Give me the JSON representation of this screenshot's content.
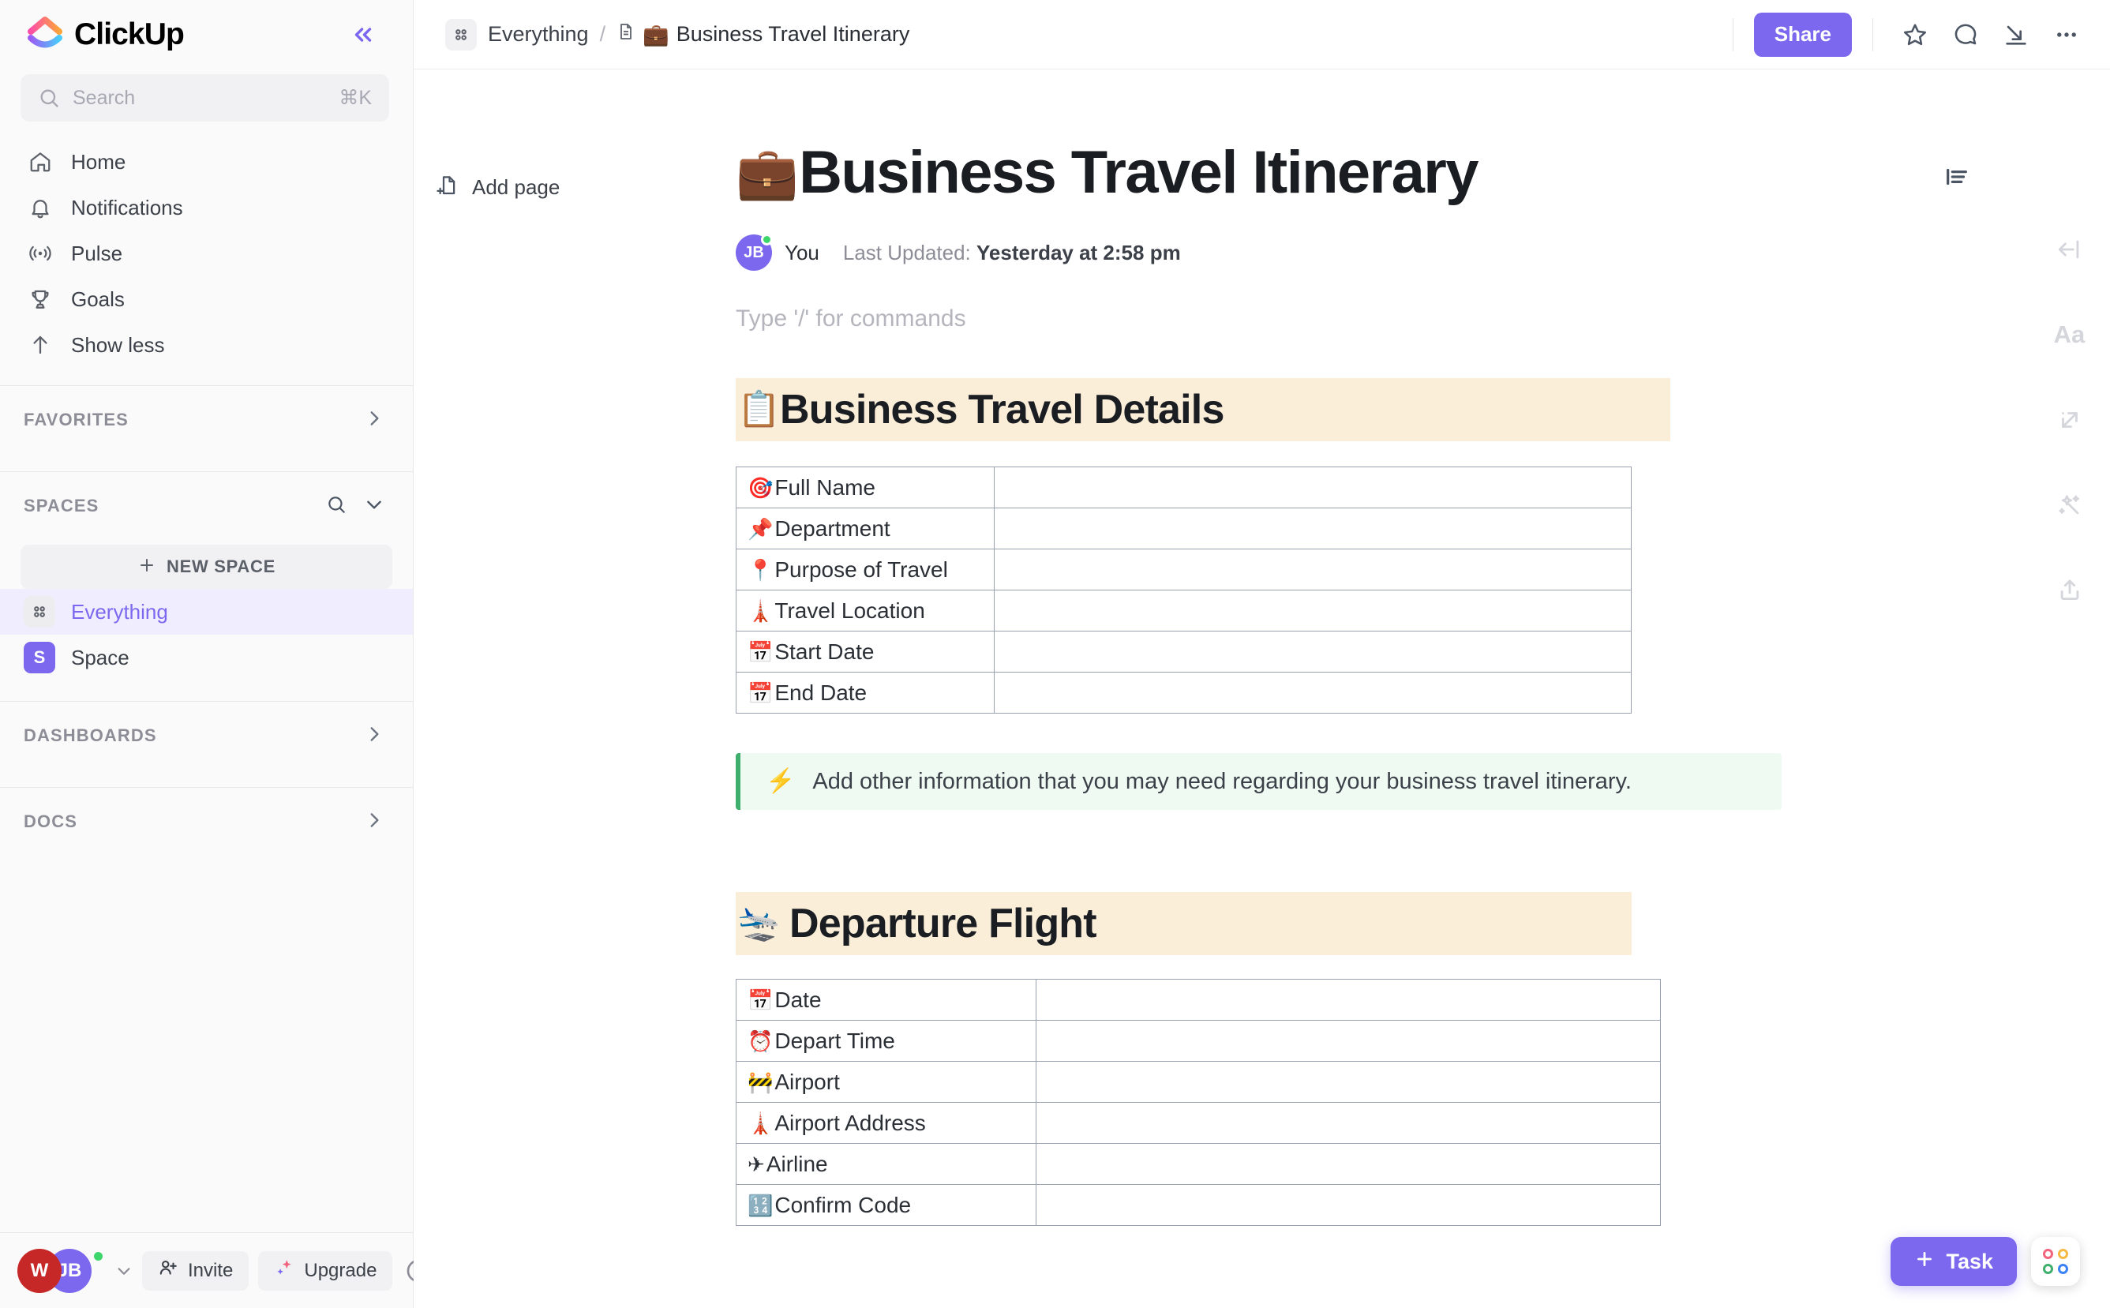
{
  "app": {
    "name": "ClickUp",
    "accent_purple": "#7b68ee",
    "section_header_bg": "#fbeed9",
    "callout_bg": "#effaf3",
    "callout_border": "#3faf6e"
  },
  "sidebar": {
    "collapse_icon": "chevrons-left-icon",
    "search": {
      "placeholder": "Search",
      "shortcut": "⌘K",
      "icon": "search-icon"
    },
    "nav": [
      {
        "label": "Home",
        "icon": "home-icon"
      },
      {
        "label": "Notifications",
        "icon": "bell-icon"
      },
      {
        "label": "Pulse",
        "icon": "pulse-icon"
      },
      {
        "label": "Goals",
        "icon": "trophy-icon"
      },
      {
        "label": "Show less",
        "icon": "arrow-up-icon"
      }
    ],
    "favorites": {
      "label": "FAVORITES",
      "chevron": "chevron-right-icon"
    },
    "spaces": {
      "label": "SPACES",
      "search_icon": "search-icon",
      "chevron": "chevron-down-icon",
      "new_space_label": "NEW SPACE",
      "items": [
        {
          "label": "Everything",
          "icon": "grid-dots-icon",
          "active": true
        },
        {
          "label": "Space",
          "initial": "S",
          "active": false
        }
      ]
    },
    "dashboards": {
      "label": "DASHBOARDS",
      "chevron": "chevron-right-icon"
    },
    "docs": {
      "label": "DOCS",
      "chevron": "chevron-right-icon"
    },
    "bottom": {
      "workspace_initial": "W",
      "user_initials": "JB",
      "caret": "chevron-down-icon",
      "invite_label": "Invite",
      "invite_icon": "user-plus-icon",
      "upgrade_label": "Upgrade",
      "upgrade_icon": "sparkles-icon",
      "help_icon": "help-circle-icon"
    }
  },
  "topbar": {
    "breadcrumb_icon": "grid-dots-icon",
    "breadcrumb_root": "Everything",
    "separator": "/",
    "doc_icon": "doc-icon",
    "breadcrumb_current_emoji": "💼",
    "breadcrumb_current": "Business Travel Itinerary",
    "share_label": "Share",
    "actions": [
      {
        "name": "favorite-star-icon"
      },
      {
        "name": "comment-icon"
      },
      {
        "name": "collapse-diagonal-icon"
      },
      {
        "name": "more-options-icon"
      }
    ]
  },
  "doc": {
    "add_page_label": "Add page",
    "add_page_icon": "page-plus-icon",
    "outline_icon": "outline-icon",
    "title_emoji": "💼",
    "title": "Business Travel Itinerary",
    "author_initials": "JB",
    "author_label": "You",
    "updated_prefix": "Last Updated:",
    "updated_value": "Yesterday at 2:58 pm",
    "command_placeholder": "Type '/' for commands",
    "sections": [
      {
        "emoji": "📋",
        "heading": "Business Travel Details",
        "rows": [
          {
            "emoji": "🎯",
            "label": "Full Name",
            "value": ""
          },
          {
            "emoji": "📌",
            "label": "Department",
            "value": ""
          },
          {
            "emoji": "📍",
            "label": "Purpose of Travel",
            "value": ""
          },
          {
            "emoji": "🗼",
            "label": "Travel Location",
            "value": ""
          },
          {
            "emoji": "📅",
            "label": "Start Date",
            "value": ""
          },
          {
            "emoji": "📅",
            "label": "End Date",
            "value": ""
          }
        ]
      },
      {
        "emoji": "🛬",
        "heading": "Departure Flight",
        "rows": [
          {
            "emoji": "📅",
            "label": "Date",
            "value": ""
          },
          {
            "emoji": "⏰",
            "label": "Depart Time",
            "value": ""
          },
          {
            "emoji": "🚧",
            "label": "Airport",
            "value": ""
          },
          {
            "emoji": "🗼",
            "label": "Airport Address",
            "value": ""
          },
          {
            "emoji": "✈",
            "label": "Airline",
            "value": ""
          },
          {
            "emoji": "🔢",
            "label": "Confirm Code",
            "value": ""
          }
        ]
      }
    ],
    "callout": {
      "emoji": "⚡",
      "text": "Add other information that you may need regarding your business travel itinerary."
    }
  },
  "right_rail": [
    {
      "name": "collapse-left-icon"
    },
    {
      "name": "font-size-icon",
      "glyph": "Aa"
    },
    {
      "name": "relationships-icon"
    },
    {
      "name": "ai-wand-icon"
    },
    {
      "name": "share-upload-icon"
    }
  ],
  "fab": {
    "task_label": "Task",
    "plus_icon": "plus-icon",
    "apps_icon": "apps-grid-icon",
    "apps_colors": [
      "#f2637e",
      "#f5b942",
      "#3faf6e",
      "#3b82f6"
    ]
  }
}
